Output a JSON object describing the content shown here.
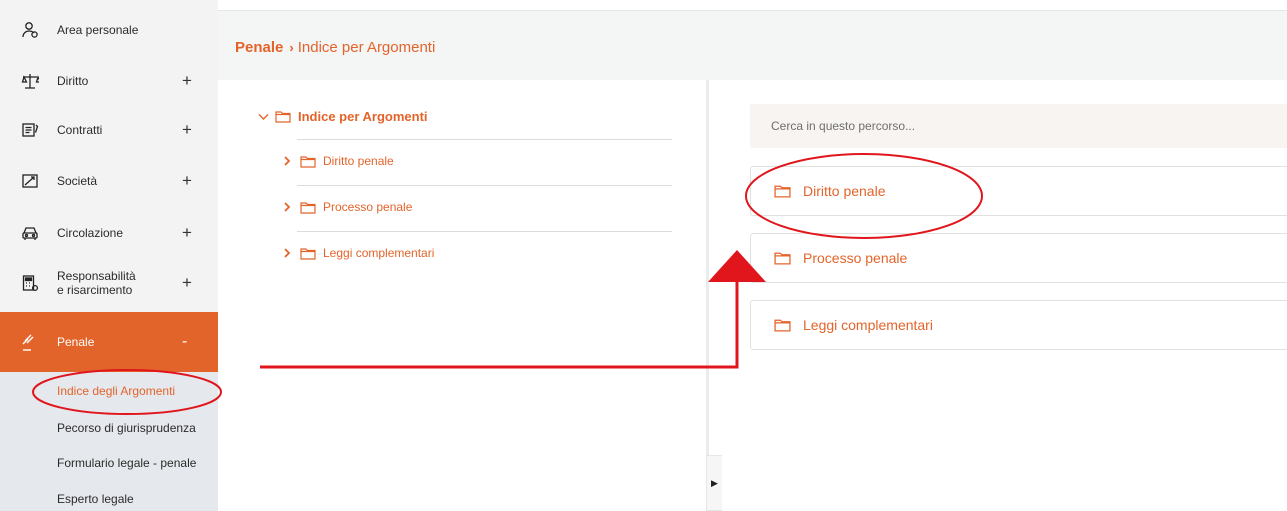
{
  "sidebar": {
    "items": [
      {
        "label": "Area personale",
        "icon": "user-icon",
        "plus": ""
      },
      {
        "label": "Diritto",
        "icon": "scales-icon",
        "plus": "+"
      },
      {
        "label": "Contratti",
        "icon": "contract-icon",
        "plus": "+"
      },
      {
        "label": "Società",
        "icon": "chart-icon",
        "plus": "+"
      },
      {
        "label": "Circolazione",
        "icon": "car-icon",
        "plus": "+"
      },
      {
        "label_line1": "Responsabilità",
        "label_line2": "e risarcimento",
        "icon": "calculator-icon",
        "plus": "+"
      },
      {
        "label": "Penale",
        "icon": "gavel-icon",
        "plus": "-"
      }
    ],
    "submenu": [
      "Indice degli Argomenti",
      "Pecorso di giurisprudenza",
      "Formulario legale - penale",
      "Esperto legale"
    ]
  },
  "breadcrumb": {
    "root": "Penale",
    "separator": "›",
    "current": "Indice per Argomenti"
  },
  "tree": {
    "root": "Indice per Argomenti",
    "children": [
      "Diritto penale",
      "Processo penale",
      "Leggi complementari"
    ]
  },
  "search": {
    "placeholder": "Cerca in questo percorso..."
  },
  "cards": [
    "Diritto penale",
    "Processo penale",
    "Leggi complementari"
  ],
  "colors": {
    "accent": "#e3642b",
    "annotation": "#e0161c",
    "submenu_bg": "#e5e8ec"
  }
}
